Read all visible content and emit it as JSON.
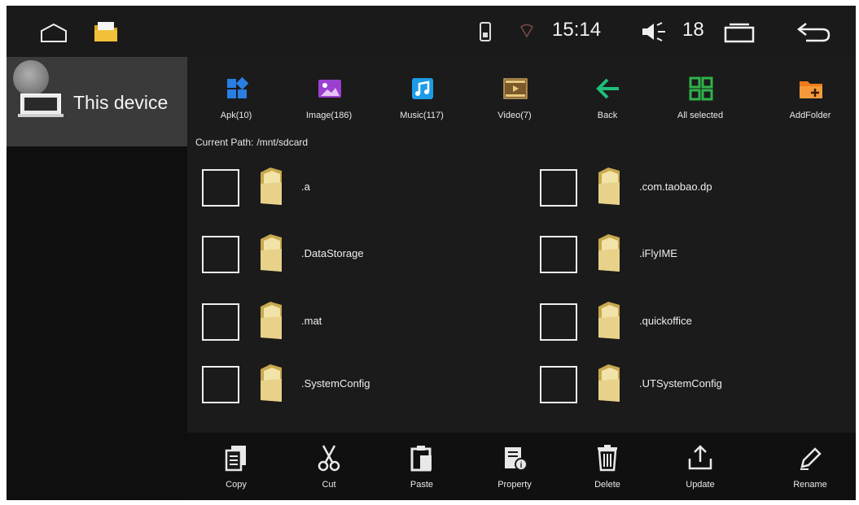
{
  "status_bar": {
    "time": "15:14",
    "volume": "18",
    "icons": [
      "home-icon",
      "folder-app-icon",
      "sd-card-icon",
      "signal-icon",
      "volume-icon",
      "recent-apps-icon",
      "back-arrow-icon"
    ]
  },
  "sidebar": {
    "items": [
      {
        "label": "This device",
        "icon": "device-icon"
      }
    ]
  },
  "toolbar": {
    "items": [
      {
        "label": "Apk(10)",
        "icon": "apk-icon"
      },
      {
        "label": "Image(186)",
        "icon": "image-icon"
      },
      {
        "label": "Music(117)",
        "icon": "music-icon"
      },
      {
        "label": "Video(7)",
        "icon": "video-icon"
      },
      {
        "label": "Back",
        "icon": "back-arrow-icon"
      },
      {
        "label": "All selected",
        "icon": "select-all-icon"
      },
      {
        "label": "AddFolder",
        "icon": "add-folder-icon"
      }
    ]
  },
  "path": {
    "label": "Current Path:",
    "value": "/mnt/sdcard"
  },
  "files": [
    {
      "name": ".a"
    },
    {
      "name": ".com.taobao.dp"
    },
    {
      "name": ".DataStorage"
    },
    {
      "name": ".iFlyIME"
    },
    {
      "name": ".mat"
    },
    {
      "name": ".quickoffice"
    },
    {
      "name": ".SystemConfig"
    },
    {
      "name": ".UTSystemConfig"
    }
  ],
  "bottom_bar": {
    "items": [
      {
        "label": "Copy",
        "icon": "copy-icon"
      },
      {
        "label": "Cut",
        "icon": "scissors-icon"
      },
      {
        "label": "Paste",
        "icon": "paste-icon"
      },
      {
        "label": "Property",
        "icon": "property-icon"
      },
      {
        "label": "Delete",
        "icon": "trash-icon"
      },
      {
        "label": "Update",
        "icon": "upload-icon"
      },
      {
        "label": "Rename",
        "icon": "pencil-icon"
      }
    ]
  },
  "colors": {
    "background": "#151515",
    "sidebar_selected": "#3a3a3a",
    "apk": "#2a7de1",
    "image": "#9b3fd1",
    "music": "#1e9be6",
    "video": "#7a5a2a",
    "back": "#1fbf7a",
    "select_all": "#2fb34a",
    "add_folder": "#f07a1a",
    "folder": "#e8d28a"
  }
}
